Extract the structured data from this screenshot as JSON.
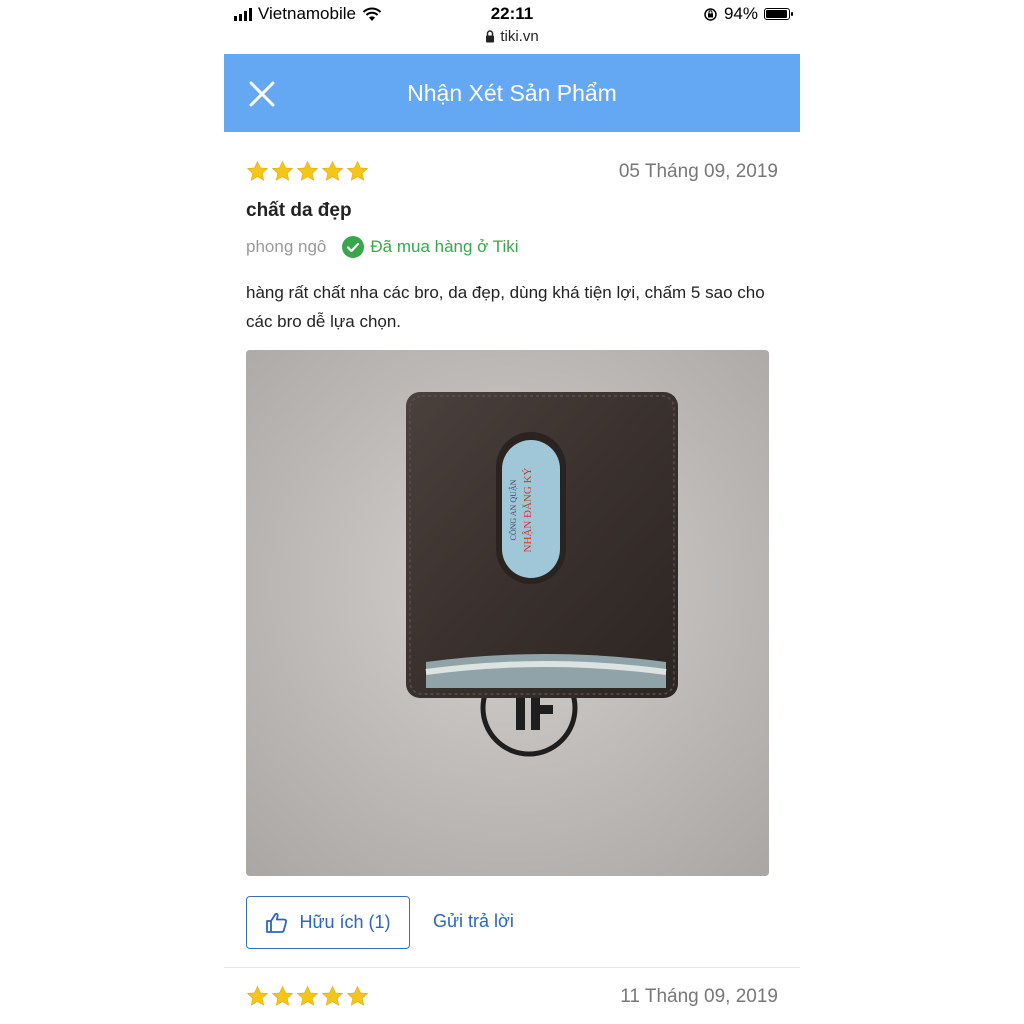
{
  "status_bar": {
    "carrier": "Vietnamobile",
    "time": "22:11",
    "url": "tiki.vn",
    "battery": "94%",
    "battery_level": 0.94
  },
  "header": {
    "title": "Nhận Xét Sản Phẩm",
    "close_icon": "close-icon",
    "background_color": "#64a7f3"
  },
  "reviews": [
    {
      "rating": 5,
      "date": "05 Tháng 09, 2019",
      "title": "chất da đẹp",
      "author": "phong ngô",
      "verified_label": "Đã mua hàng ở Tiki",
      "text": "hàng rất chất nha các bro, da đẹp, dùng khá tiện lợi, chấm 5 sao cho các bro dễ lựa chọn.",
      "helpful_label": "Hữu ích (1)",
      "reply_label": "Gửi trả lời"
    },
    {
      "rating": 5,
      "date": "11 Tháng 09, 2019"
    }
  ],
  "colors": {
    "star": "#f5c518",
    "verified": "#3aa64c",
    "link": "#2b64c1"
  }
}
